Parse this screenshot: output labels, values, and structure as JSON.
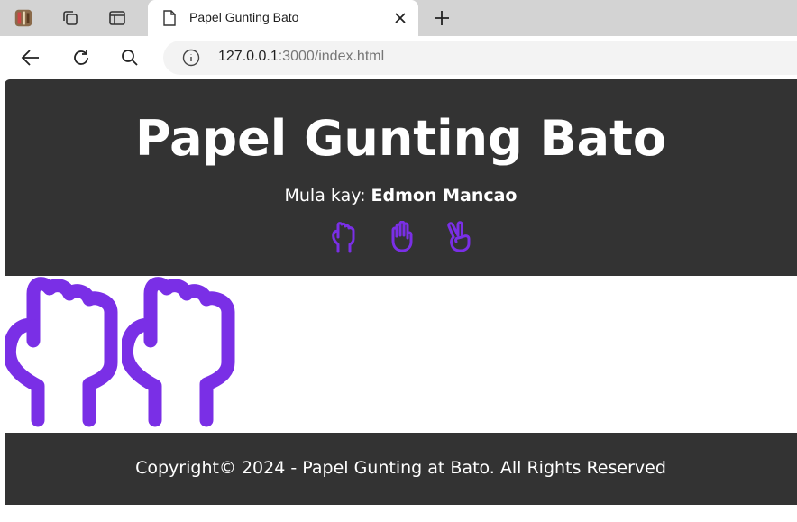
{
  "browser": {
    "tab_title": "Papel Gunting Bato",
    "url_host": "127.0.0.1",
    "url_path": ":3000/index.html"
  },
  "header": {
    "title": "Papel Gunting Bato",
    "byline_prefix": "Mula kay: ",
    "author": "Edmon Mancao",
    "choices": [
      {
        "name": "bato",
        "icon": "fist-icon"
      },
      {
        "name": "papel",
        "icon": "open-hand-icon"
      },
      {
        "name": "gunting",
        "icon": "peace-hand-icon"
      }
    ]
  },
  "arena": {
    "player_choice_icon": "fist-icon",
    "computer_choice_icon": "fist-icon"
  },
  "footer": {
    "copyright": "Copyright© 2024 - Papel Gunting at Bato. All Rights Reserved"
  },
  "colors": {
    "accent": "#7a2fe6",
    "dark_bg": "#333333"
  }
}
